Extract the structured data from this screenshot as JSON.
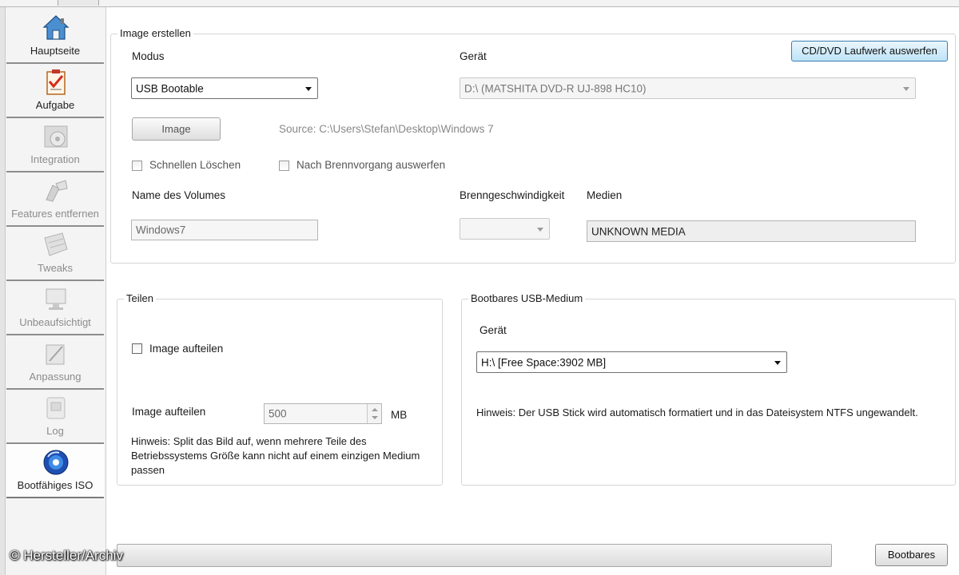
{
  "sidebar": {
    "items": [
      {
        "label": "Hauptseite",
        "icon": "house-icon",
        "state": "normal"
      },
      {
        "label": "Aufgabe",
        "icon": "checklist-icon",
        "state": "normal"
      },
      {
        "label": "Integration",
        "icon": "disc-install-icon",
        "state": "disabled"
      },
      {
        "label": "Features entfernen",
        "icon": "remove-features-icon",
        "state": "disabled"
      },
      {
        "label": "Tweaks",
        "icon": "tweaks-icon",
        "state": "disabled"
      },
      {
        "label": "Unbeaufsichtigt",
        "icon": "monitor-icon",
        "state": "disabled"
      },
      {
        "label": "Anpassung",
        "icon": "customize-icon",
        "state": "disabled"
      },
      {
        "label": "Log",
        "icon": "log-icon",
        "state": "disabled"
      },
      {
        "label": "Bootfähiges ISO",
        "icon": "boot-disc-icon",
        "state": "active"
      }
    ]
  },
  "image_group": {
    "legend": "Image erstellen",
    "eject_button": "CD/DVD Laufwerk auswerfen",
    "modus_label": "Modus",
    "modus_value": "USB Bootable",
    "geraet_label": "Gerät",
    "geraet_value": "D:\\ (MATSHITA DVD-R   UJ-898   HC10)",
    "image_button": "Image",
    "source_text": "Source: C:\\Users\\Stefan\\Desktop\\Windows 7",
    "quick_erase_label": "Schnellen Löschen",
    "eject_after_label": "Nach Brennvorgang auswerfen",
    "volume_label": "Name des Volumes",
    "volume_value": "Windows7",
    "speed_label": "Brenngeschwindigkeit",
    "speed_value": "",
    "media_label": "Medien",
    "media_value": "UNKNOWN MEDIA"
  },
  "split_group": {
    "legend": "Teilen",
    "split_checkbox_label": "Image aufteilen",
    "size_label": "Image aufteilen",
    "size_value": "500",
    "size_unit": "MB",
    "hint": "Hinweis: Split das Bild auf, wenn mehrere Teile des Betriebssystems Größe kann nicht auf einem einzigen Medium passen"
  },
  "usb_group": {
    "legend": "Bootbares USB-Medium",
    "geraet_label": "Gerät",
    "geraet_value": "H:\\ [Free Space:3902 MB]",
    "hint": "Hinweis: Der USB Stick wird automatisch formatiert und in das Dateisystem NTFS ungewandelt."
  },
  "footer": {
    "progress_fraction": 0.0,
    "progress_color": "#37b737",
    "action_button": "Bootbares",
    "watermark": "© Hersteller/Archiv"
  },
  "colors": {
    "primary_button": "#bde3f8",
    "disabled_text": "#888888",
    "group_border": "#d6d6d6"
  }
}
